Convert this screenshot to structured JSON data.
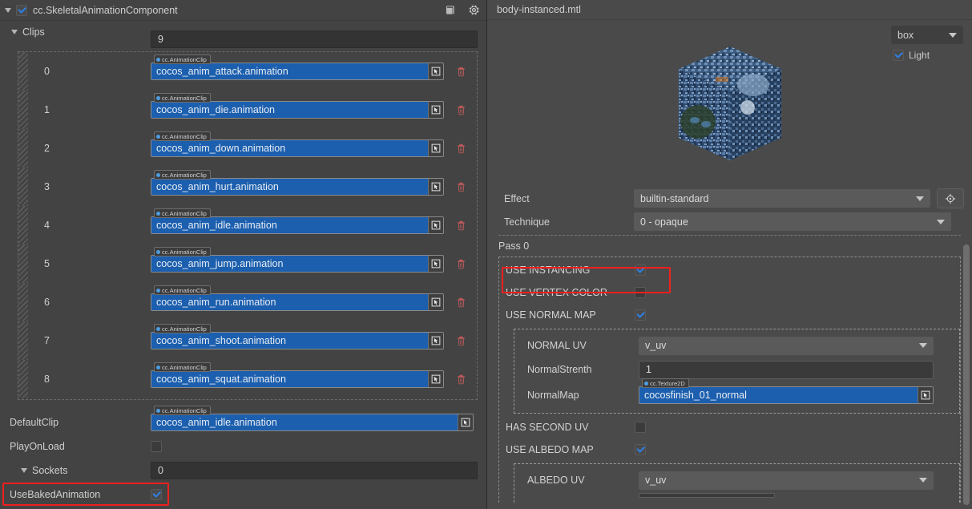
{
  "left": {
    "component": {
      "title": "cc.SkeletalAnimationComponent",
      "enabled": true,
      "help_icon": "book-icon",
      "settings_icon": "gear-icon"
    },
    "clips": {
      "label": "Clips",
      "count": "9",
      "asset_type": "cc.AnimationClip",
      "items": [
        {
          "index": "0",
          "value": "cocos_anim_attack.animation"
        },
        {
          "index": "1",
          "value": "cocos_anim_die.animation"
        },
        {
          "index": "2",
          "value": "cocos_anim_down.animation"
        },
        {
          "index": "3",
          "value": "cocos_anim_hurt.animation"
        },
        {
          "index": "4",
          "value": "cocos_anim_idle.animation"
        },
        {
          "index": "5",
          "value": "cocos_anim_jump.animation"
        },
        {
          "index": "6",
          "value": "cocos_anim_run.animation"
        },
        {
          "index": "7",
          "value": "cocos_anim_shoot.animation"
        },
        {
          "index": "8",
          "value": "cocos_anim_squat.animation"
        }
      ]
    },
    "default_clip": {
      "label": "DefaultClip",
      "asset_type": "cc.AnimationClip",
      "value": "cocos_anim_idle.animation"
    },
    "play_on_load": {
      "label": "PlayOnLoad",
      "checked": false
    },
    "sockets": {
      "label": "Sockets",
      "count": "0"
    },
    "use_baked_animation": {
      "label": "UseBakedAnimation",
      "checked": true,
      "highlighted": true
    }
  },
  "right": {
    "title": "body-instanced.mtl",
    "preview": {
      "shape": "box",
      "light_label": "Light",
      "light_checked": true
    },
    "effect": {
      "label": "Effect",
      "value": "builtin-standard",
      "add_icon": "target-icon"
    },
    "technique": {
      "label": "Technique",
      "value": "0 - opaque"
    },
    "pass_label": "Pass 0",
    "defines": [
      {
        "label": "USE INSTANCING",
        "checked": true,
        "highlighted": true
      },
      {
        "label": "USE VERTEX COLOR",
        "checked": false,
        "highlighted": false
      },
      {
        "label": "USE NORMAL MAP",
        "checked": true,
        "highlighted": false
      }
    ],
    "normal_group": {
      "uv": {
        "label": "NORMAL UV",
        "value": "v_uv"
      },
      "strength": {
        "label": "NormalStrenth",
        "value": "1"
      },
      "map": {
        "label": "NormalMap",
        "asset_type": "cc.Texture2D",
        "value": "cocosfinish_01_normal"
      }
    },
    "defines2": [
      {
        "label": "HAS SECOND UV",
        "checked": false
      },
      {
        "label": "USE ALBEDO MAP",
        "checked": true
      }
    ],
    "albedo_group": {
      "uv": {
        "label": "ALBEDO UV",
        "value": "v_uv"
      }
    }
  },
  "colors": {
    "accent_blue": "#1c5fae",
    "highlight_red": "#f21f1f",
    "check_blue": "#2f7fe0",
    "panel_left": "#434343",
    "panel_right": "#4a4a4a"
  }
}
